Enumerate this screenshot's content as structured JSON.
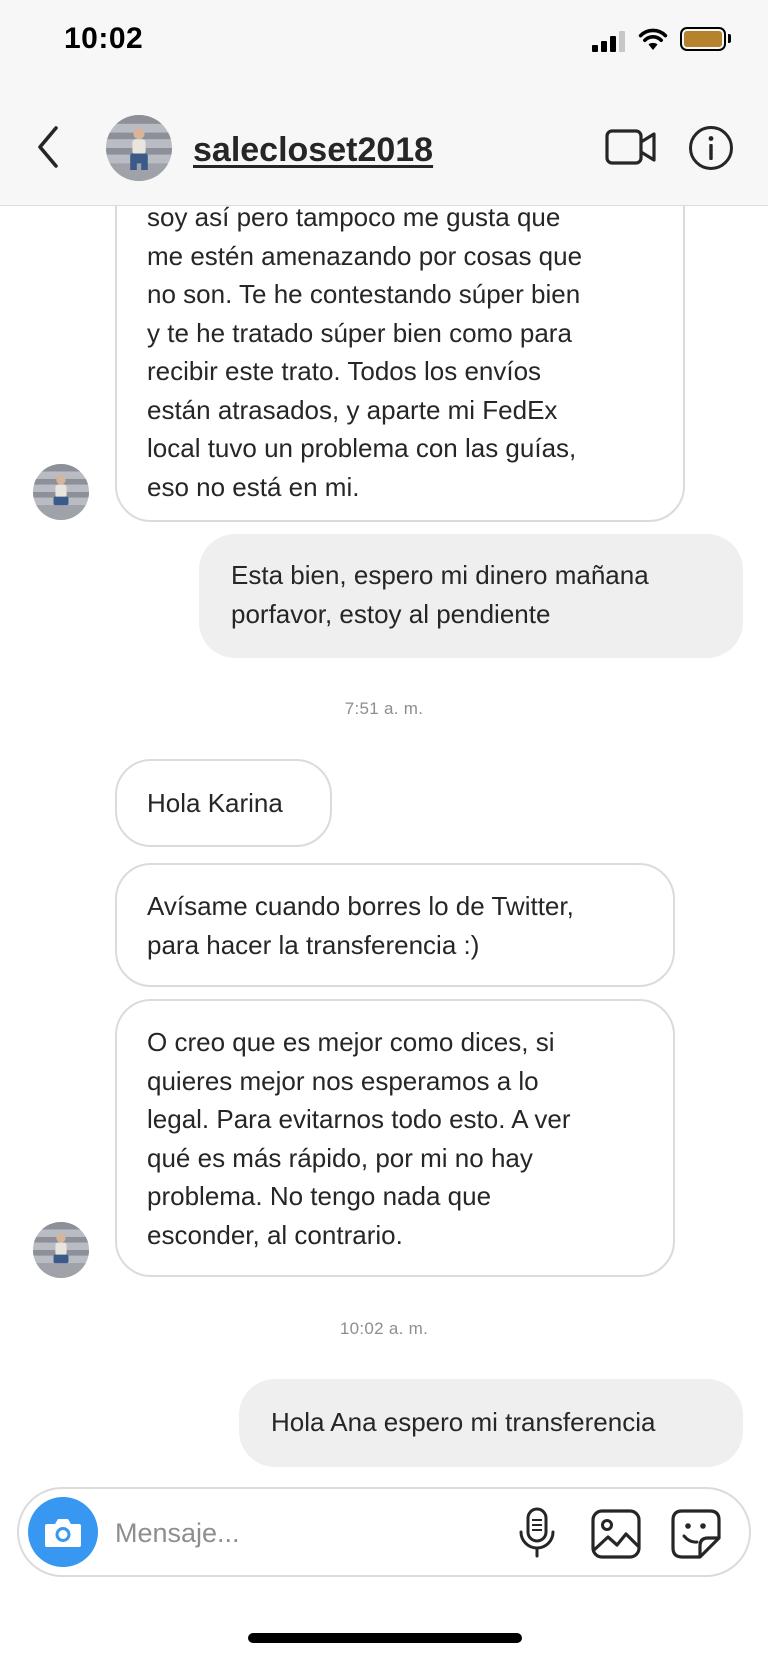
{
  "status_bar": {
    "time": "10:02",
    "battery_color": "#b5822d"
  },
  "header": {
    "username": "salecloset2018",
    "icons": [
      "chevron-left-icon",
      "video-camera-icon",
      "info-icon"
    ]
  },
  "messages": [
    {
      "direction": "incoming",
      "lines": [
        "soy así pero tampoco me gusta que",
        "me estén amenazando por cosas que",
        "no son. Te he contestando súper bien",
        "y te he tratado súper bien como para",
        "recibir este trato. Todos los envíos",
        "están atrasados, y aparte mi FedEx",
        "local tuvo un problema con las guías,",
        "eso no está en mi."
      ]
    },
    {
      "direction": "outgoing",
      "lines": [
        "Esta bien, espero mi dinero mañana",
        "porfavor, estoy al pendiente"
      ]
    },
    {
      "type": "timestamp",
      "text": "7:51 a. m."
    },
    {
      "direction": "incoming",
      "lines": [
        "Hola Karina"
      ]
    },
    {
      "direction": "incoming",
      "lines": [
        "Avísame cuando borres lo de Twitter,",
        "para hacer la transferencia :)"
      ]
    },
    {
      "direction": "incoming",
      "lines": [
        "O creo que es mejor como dices, si",
        "quieres mejor nos esperamos a lo",
        "legal. Para evitarnos todo esto. A ver",
        "qué es más rápido, por mi no hay",
        "problema. No tengo nada que",
        "esconder, al contrario."
      ]
    },
    {
      "type": "timestamp",
      "text": "10:02 a. m."
    },
    {
      "direction": "outgoing",
      "lines": [
        "Hola Ana espero mi transferencia"
      ]
    }
  ],
  "composer": {
    "placeholder": "Mensaje...",
    "accent_color": "#3897f0",
    "icons": [
      "camera-icon",
      "microphone-icon",
      "gallery-icon",
      "sticker-icon"
    ]
  }
}
